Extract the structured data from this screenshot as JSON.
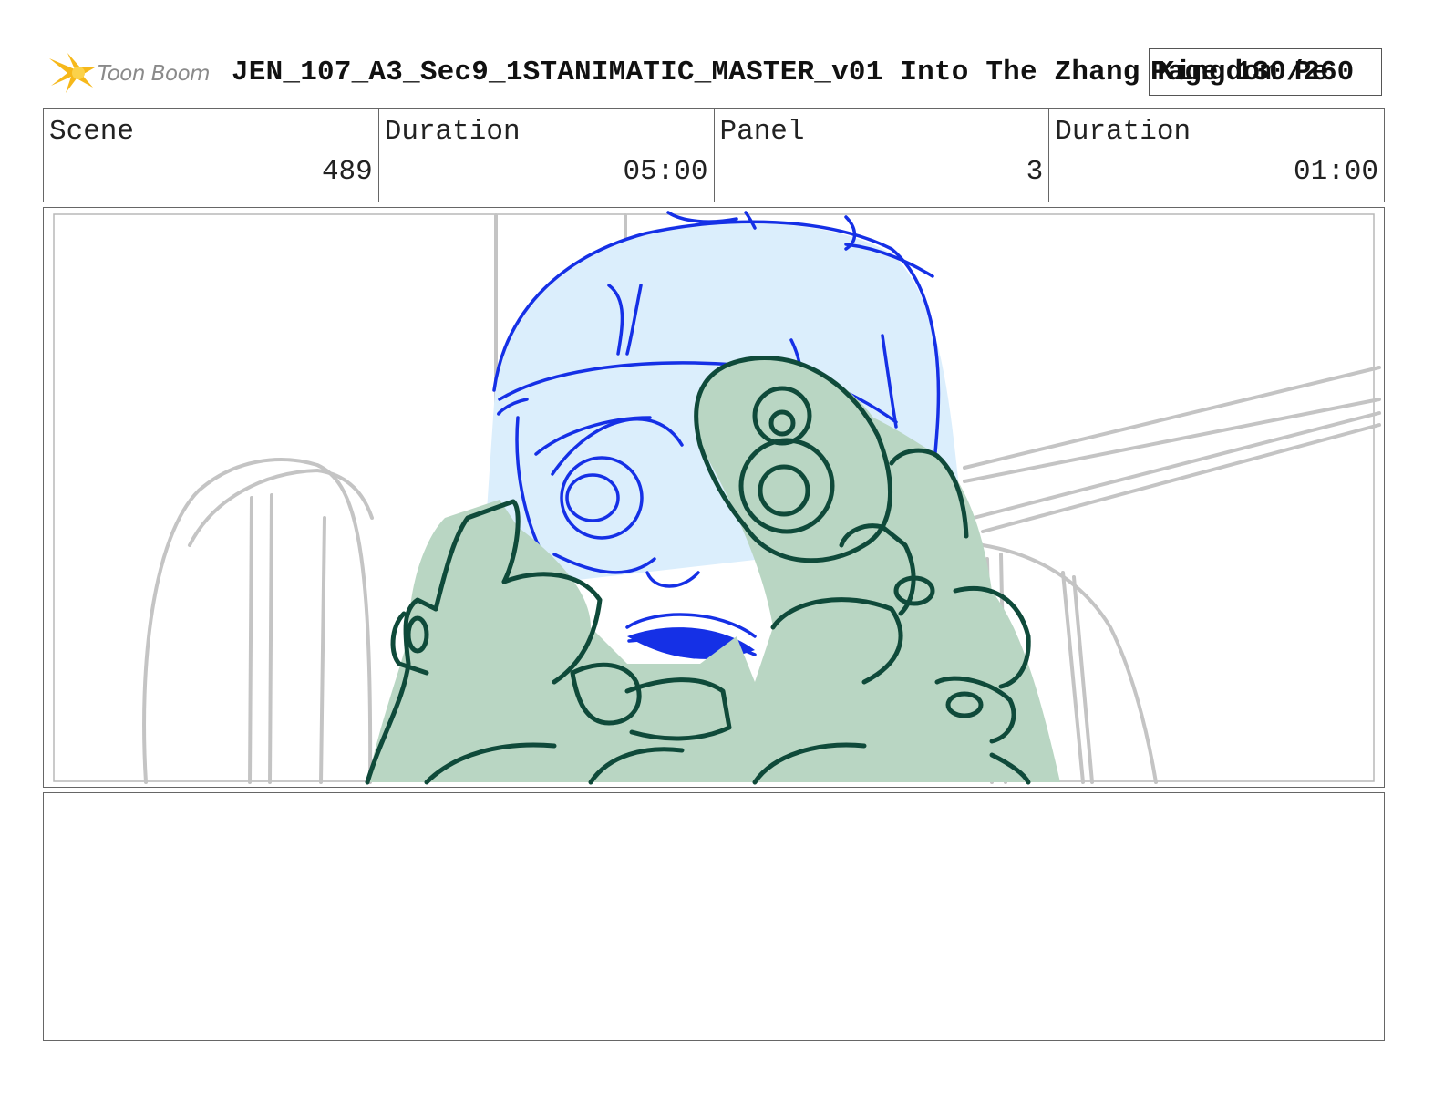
{
  "header": {
    "logo_text": "Toon Boom",
    "document_title": "JEN_107_A3_Sec9_1STANIMATIC_MASTER_v01  Into The Zhang Kingdom Pe",
    "page_label": "Page 130/260"
  },
  "info": {
    "scene_label": "Scene",
    "scene_value": "489",
    "scene_duration_label": "Duration",
    "scene_duration_value": "05:00",
    "panel_label": "Panel",
    "panel_value": "3",
    "panel_duration_label": "Duration",
    "panel_duration_value": "01:00"
  },
  "colors": {
    "rough_lines": "#c4c4c4",
    "character_lines": "#1530e6",
    "character_fill": "#dbeefc",
    "armor_lines": "#0f4a3a",
    "armor_fill": "#b9d6c3",
    "logo_star": "#f6b81a"
  },
  "icons": {
    "logo": "toon-boom-star-icon"
  },
  "notes": {
    "text": ""
  }
}
